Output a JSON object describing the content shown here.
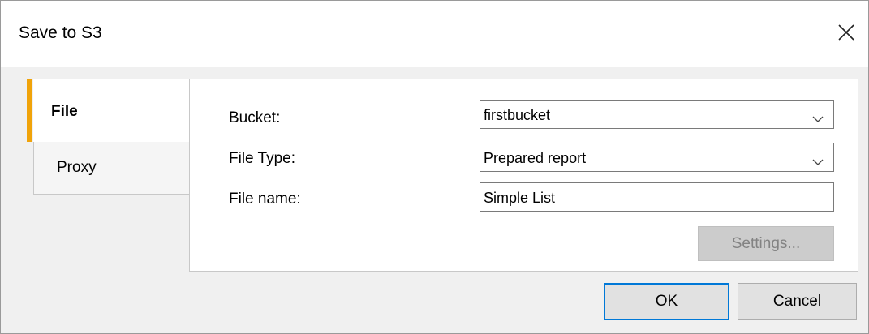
{
  "dialog": {
    "title": "Save to S3",
    "close_icon": "close-icon"
  },
  "tabs": [
    {
      "label": "File",
      "selected": true
    },
    {
      "label": "Proxy",
      "selected": false
    }
  ],
  "colors": {
    "tab_accent": "#f0a30a",
    "ok_focus_border": "#0078d7"
  },
  "form": {
    "bucket_label": "Bucket:",
    "bucket_value": "firstbucket",
    "file_type_label": "File Type:",
    "file_type_value": "Prepared report",
    "file_name_label": "File name:",
    "file_name_value": "Simple List",
    "settings_label": "Settings...",
    "dropdown_icon": "chevron-down-icon"
  },
  "buttons": {
    "ok_label": "OK",
    "cancel_label": "Cancel"
  }
}
